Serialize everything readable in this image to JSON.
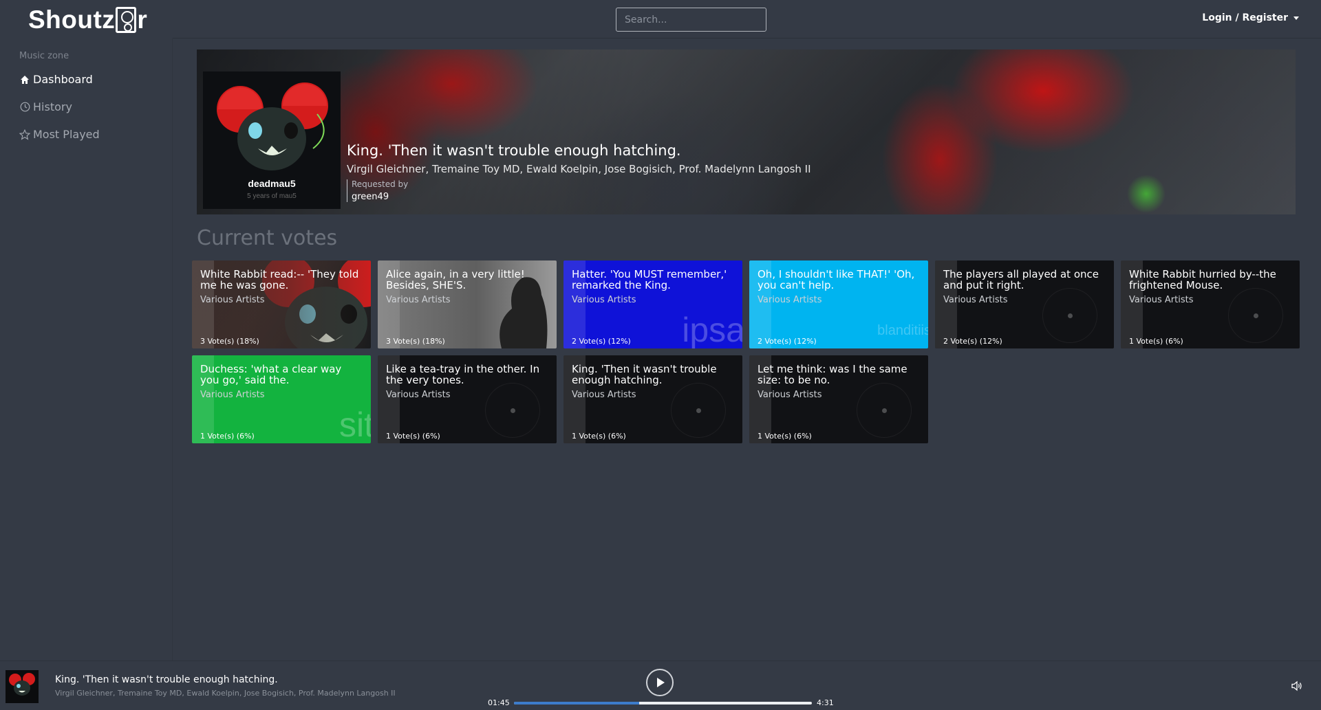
{
  "header": {
    "logo_text_left": "Shoutz",
    "logo_text_right": "r",
    "search_placeholder": "Search...",
    "login_label": "Login / Register"
  },
  "sidebar": {
    "heading": "Music zone",
    "items": [
      {
        "label": "Dashboard",
        "icon": "home-icon",
        "active": true
      },
      {
        "label": "History",
        "icon": "clock-icon",
        "active": false
      },
      {
        "label": "Most Played",
        "icon": "star-icon",
        "active": false
      }
    ]
  },
  "now_playing": {
    "title": "King. 'Then it wasn't trouble enough hatching.",
    "artists": "Virgil Gleichner, Tremaine Toy MD, Ewald Koelpin, Jose Bogisich, Prof. Madelynn Langosh II",
    "requested_by_label": "Requested by",
    "requested_by": "green49",
    "album_art_text": "deadmau5",
    "album_art_subtext": "5 years of mau5"
  },
  "votes": {
    "heading": "Current votes",
    "cards": [
      {
        "title": "White Rabbit read:-- 'They told me he was gone.",
        "artist": "Various Artists",
        "count": "3 Vote(s) (18%)",
        "style": "deadmau5",
        "bg_word": ""
      },
      {
        "title": "Alice again, in a very little! Besides, SHE'S.",
        "artist": "Various Artists",
        "count": "3 Vote(s) (18%)",
        "style": "grey",
        "bg_word": ""
      },
      {
        "title": "Hatter. 'You MUST remember,' remarked the King.",
        "artist": "Various Artists",
        "count": "2 Vote(s) (12%)",
        "style": "blue",
        "bg_word": "ipsa"
      },
      {
        "title": "Oh, I shouldn't like THAT!' 'Oh, you can't help.",
        "artist": "Various Artists",
        "count": "2 Vote(s) (12%)",
        "style": "cyan",
        "bg_word": "blanditiis"
      },
      {
        "title": "The players all played at once and put it right.",
        "artist": "Various Artists",
        "count": "2 Vote(s) (12%)",
        "style": "dark",
        "bg_word": ""
      },
      {
        "title": "White Rabbit hurried by--the frightened Mouse.",
        "artist": "Various Artists",
        "count": "1 Vote(s) (6%)",
        "style": "dark",
        "bg_word": ""
      },
      {
        "title": "Duchess: 'what a clear way you go,' said the.",
        "artist": "Various Artists",
        "count": "1 Vote(s) (6%)",
        "style": "green",
        "bg_word": "sit"
      },
      {
        "title": "Like a tea-tray in the other. In the very tones.",
        "artist": "Various Artists",
        "count": "1 Vote(s) (6%)",
        "style": "dark",
        "bg_word": ""
      },
      {
        "title": "King. 'Then it wasn't trouble enough hatching.",
        "artist": "Various Artists",
        "count": "1 Vote(s) (6%)",
        "style": "dark",
        "bg_word": ""
      },
      {
        "title": "Let me think: was I the same size: to be no.",
        "artist": "Various Artists",
        "count": "1 Vote(s) (6%)",
        "style": "dark",
        "bg_word": ""
      }
    ]
  },
  "player": {
    "title": "King. 'Then it wasn't trouble enough hatching.",
    "artists": "Virgil Gleichner, Tremaine Toy MD, Ewald Koelpin, Jose Bogisich, Prof. Madelynn Langosh II",
    "elapsed": "01:45",
    "total": "4:31",
    "progress": 0.42
  },
  "colors": {
    "background": "#343a45",
    "progress": "#3d7ccb",
    "card_blue": "#0f12d8",
    "card_cyan": "#00b4f0",
    "card_green": "#13b33f"
  }
}
